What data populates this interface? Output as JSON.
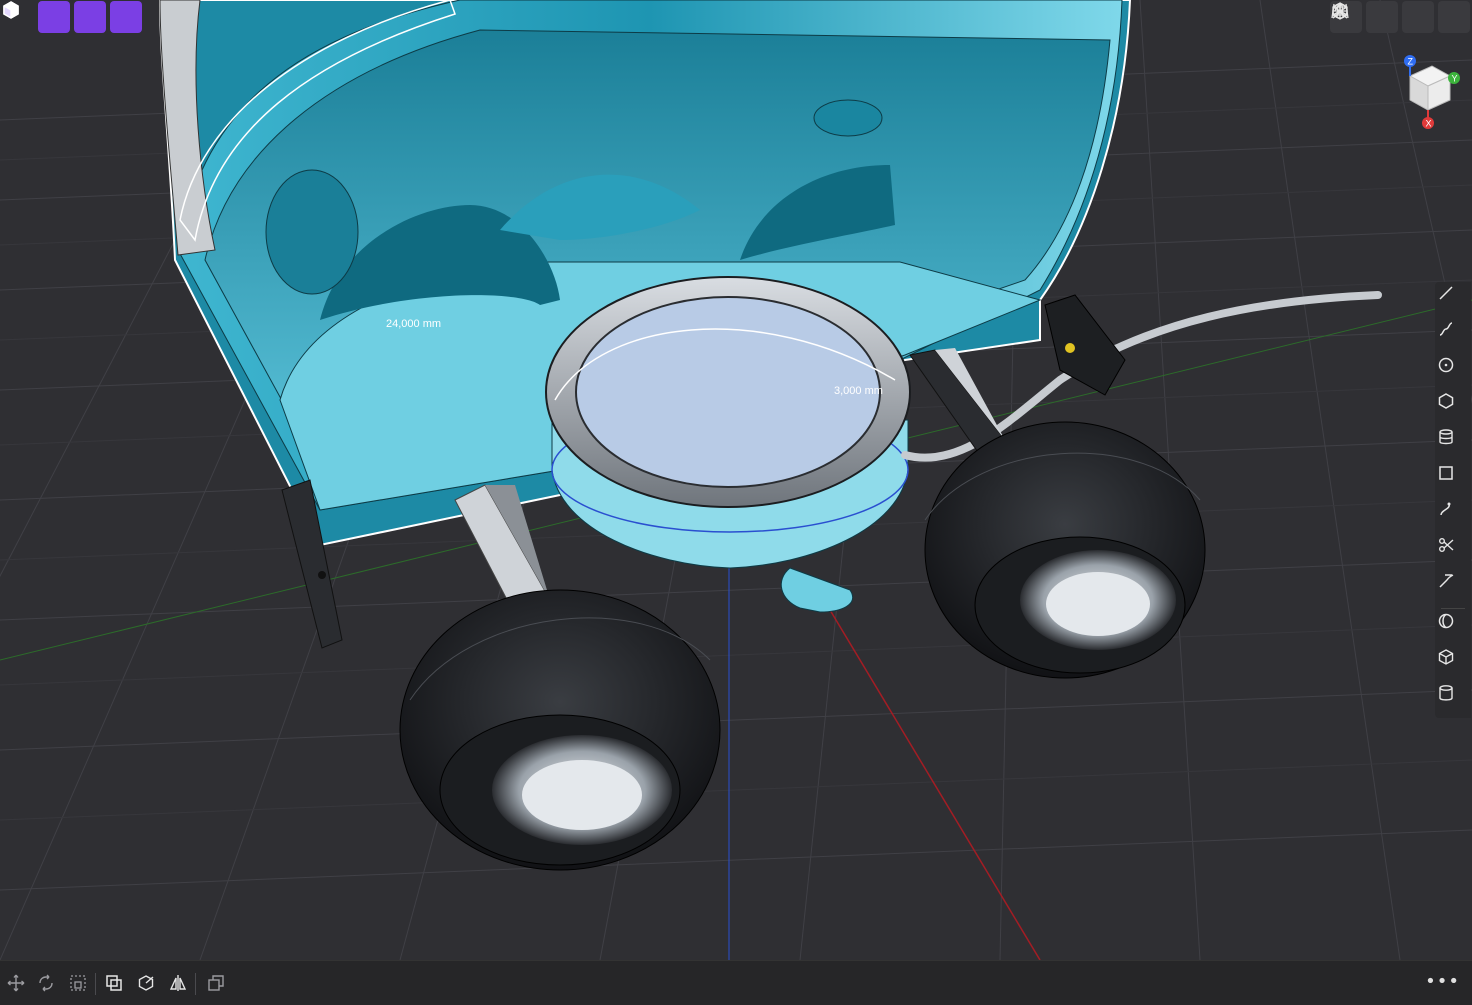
{
  "viewport": {
    "dimensions": [
      {
        "id": "dim-width",
        "text": "24,000 mm"
      },
      {
        "id": "dim-radius",
        "text": "3,000 mm"
      }
    ]
  },
  "toolbar_left": [
    {
      "name": "select-icon",
      "active": false
    },
    {
      "name": "view-mode-icon",
      "active": true
    },
    {
      "name": "solid-view-icon",
      "active": true
    },
    {
      "name": "wireframe-view-icon",
      "active": true
    }
  ],
  "toolbar_right": [
    "grid-icon",
    "axes-icon",
    "render-icon",
    "environment-icon"
  ],
  "view_cube": {
    "axes": [
      "Z",
      "Y",
      "X"
    ]
  },
  "right_rail": [
    "line-icon",
    "spline-icon",
    "circle-icon",
    "polygon-icon",
    "stack-icon",
    "rectangle-icon",
    "curve-icon",
    "trim-icon",
    "extend-icon",
    "shell-icon",
    "box-icon",
    "cylinder-icon"
  ],
  "bottom_bar": {
    "tools": [
      "move-icon",
      "rotate-icon",
      "scale-icon",
      "boolean-icon",
      "transform-icon",
      "mirror-icon",
      "pattern-icon"
    ],
    "more": "•••"
  },
  "colors": {
    "accent": "#7b3fe4",
    "model_body": "#5ec6dc",
    "model_dark": "#1f8fa8",
    "grid": "#3c3c40",
    "background": "#2f2f33"
  }
}
